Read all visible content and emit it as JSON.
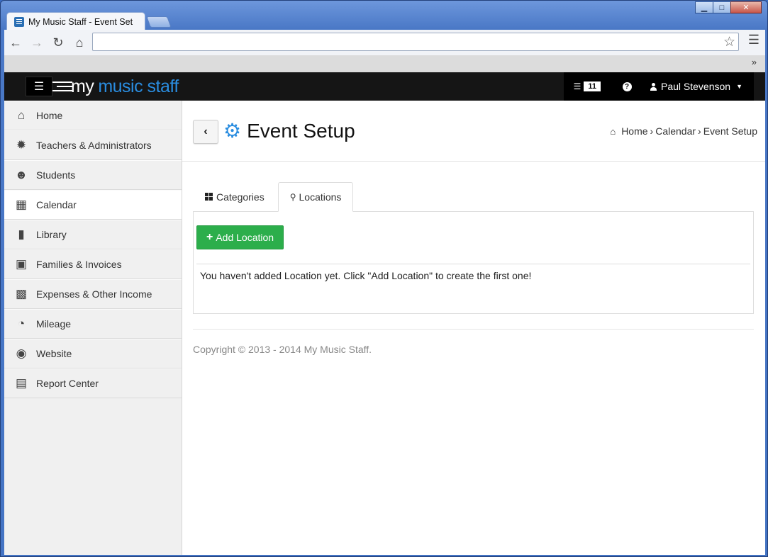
{
  "browser": {
    "tab_title": "My Music Staff - Event Set",
    "window_controls": [
      "minimize",
      "maximize",
      "close"
    ],
    "bookmarks_overflow": "»"
  },
  "navbar": {
    "logo_my": "my",
    "logo_rest": "music staff",
    "rss_count": "11",
    "help_label": "?",
    "user_name": "Paul Stevenson"
  },
  "sidebar": {
    "items": [
      {
        "label": "Home",
        "icon": "home-icon"
      },
      {
        "label": "Teachers & Administrators",
        "icon": "badge-icon"
      },
      {
        "label": "Students",
        "icon": "users-icon"
      },
      {
        "label": "Calendar",
        "icon": "calendar-icon",
        "active": true
      },
      {
        "label": "Library",
        "icon": "book-icon"
      },
      {
        "label": "Families & Invoices",
        "icon": "money-icon"
      },
      {
        "label": "Expenses & Other Income",
        "icon": "chart-icon"
      },
      {
        "label": "Mileage",
        "icon": "dashboard-icon"
      },
      {
        "label": "Website",
        "icon": "globe-icon"
      },
      {
        "label": "Report Center",
        "icon": "document-icon"
      }
    ]
  },
  "page": {
    "title": "Event Setup",
    "breadcrumb": [
      "Home",
      "Calendar",
      "Event Setup"
    ],
    "tabs": [
      {
        "label": "Categories",
        "icon": "grid-icon",
        "active": false
      },
      {
        "label": "Locations",
        "icon": "map-marker-icon",
        "active": true
      }
    ],
    "add_button": "Add Location",
    "empty_message": "You haven't added Location yet. Click \"Add Location\" to create the first one!",
    "copyright": "Copyright © 2013 - 2014 My Music Staff."
  },
  "colors": {
    "accent": "#2a8de0",
    "success": "#2cae4b",
    "navbar": "#151515"
  }
}
